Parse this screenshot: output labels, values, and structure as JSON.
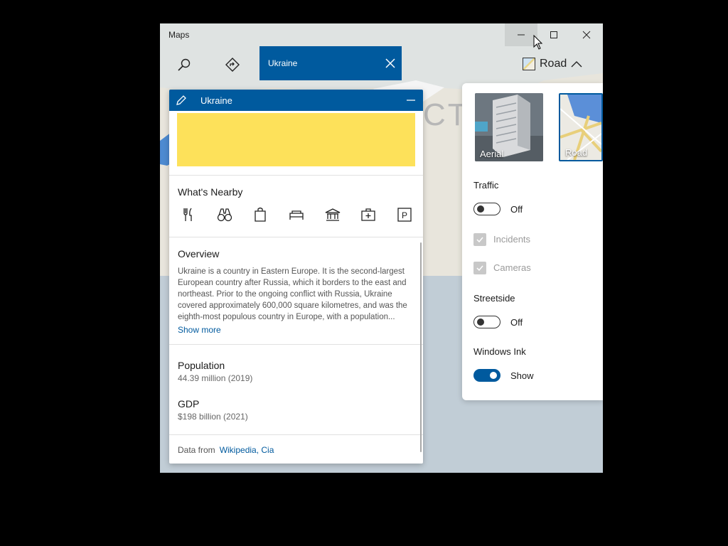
{
  "app": {
    "title": "Maps"
  },
  "search": {
    "query": "Ukraine"
  },
  "map_style": {
    "label": "Road"
  },
  "map": {
    "label": "CTIC"
  },
  "card": {
    "title": "Ukraine",
    "flag_color": "#fde15a",
    "nearby": {
      "title": "What's Nearby",
      "icons": [
        "restaurant-icon",
        "binoculars-icon",
        "shopping-bag-icon",
        "hotel-icon",
        "museum-icon",
        "hospital-icon",
        "parking-icon"
      ]
    },
    "overview": {
      "title": "Overview",
      "text": "Ukraine is a country in Eastern Europe. It is the second-largest European country after Russia, which it borders to the east and northeast. Prior to the ongoing conflict with Russia, Ukraine covered approximately 600,000 square kilometres, and was the eighth-most populous country in Europe, with a population...",
      "show_more": "Show more"
    },
    "population": {
      "label": "Population",
      "value": "44.39 million (2019)"
    },
    "gdp": {
      "label": "GDP",
      "value": "$198 billion (2021)"
    },
    "source": {
      "prefix": "Data from",
      "links": "Wikipedia, Cia"
    }
  },
  "layers": {
    "aerial_label": "Aerial",
    "road_label": "Road",
    "traffic": {
      "label": "Traffic",
      "state": "Off"
    },
    "incidents_label": "Incidents",
    "cameras_label": "Cameras",
    "streetside": {
      "label": "Streetside",
      "state": "Off"
    },
    "windows_ink": {
      "label": "Windows Ink",
      "state": "Show"
    }
  },
  "colors": {
    "accent": "#005a9e",
    "map_land": "#e6e3da",
    "map_water": "#c1cdd6"
  }
}
